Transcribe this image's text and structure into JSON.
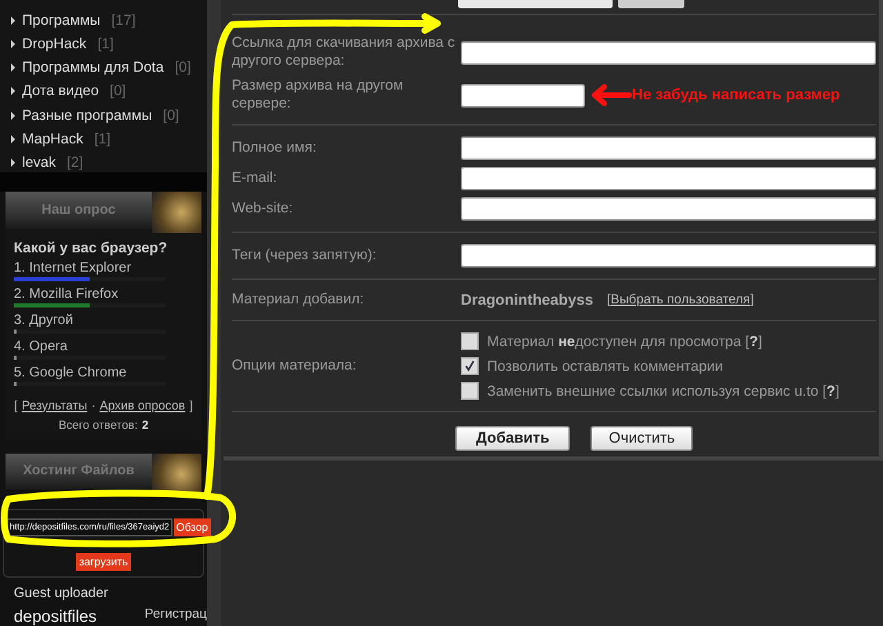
{
  "categories": [
    {
      "name": "Программы",
      "count": "[17]"
    },
    {
      "name": "DropHack",
      "count": "[1]"
    },
    {
      "name": "Программы для Dota",
      "count": "[0]"
    },
    {
      "name": "Дота видео",
      "count": "[0]"
    },
    {
      "name": "Разные программы",
      "count": "[0]"
    },
    {
      "name": "MapHack",
      "count": "[1]"
    },
    {
      "name": "levak",
      "count": "[2]"
    }
  ],
  "poll": {
    "title": "Наш опрос",
    "question": "Какой у вас браузер?",
    "answers": [
      {
        "label": "1. Internet Explorer",
        "level": 0.5,
        "color": "#2b3fd6"
      },
      {
        "label": "2. Mozilla Firefox",
        "level": 0.5,
        "color": "#1f7a2e"
      },
      {
        "label": "3. Другой",
        "level": 0,
        "color": "#888888"
      },
      {
        "label": "4. Opera",
        "level": 0,
        "color": "#888888"
      },
      {
        "label": "5. Google Chrome",
        "level": 0,
        "color": "#888888"
      }
    ],
    "open_bracket": "[",
    "links": [
      "Результаты",
      "Архив опросов"
    ],
    "separator": "·",
    "close_bracket": "]",
    "total_label": "Всего ответов:",
    "total": "2"
  },
  "hosting": {
    "title": "Хостинг Файлов",
    "url": "http://depositfiles.com/ru/files/367eaiyd2",
    "browse": "Обзор",
    "upload": "загрузить",
    "uploader": "Guest uploader",
    "service": "depositfiles",
    "register": "Регистрац"
  },
  "form": {
    "sections": [
      [
        {
          "kind": "field",
          "label": "Ссылка для скачивания архива с другого сервера:"
        },
        {
          "kind": "short_field",
          "label": "Размер архива на другом сервере:",
          "note": "Не забудь написать размер"
        }
      ],
      [
        {
          "kind": "field",
          "label": "Полное имя:"
        },
        {
          "kind": "field",
          "label": "E-mail:"
        },
        {
          "kind": "field",
          "label": "Web-site:"
        }
      ],
      [
        {
          "kind": "field",
          "label": "Теги (через запятую):"
        }
      ],
      [
        {
          "kind": "author",
          "label": "Материал добавил:",
          "value": "Dragonintheabyss",
          "open_bracket": "[",
          "link": "Выбрать пользователя",
          "close_bracket": "]"
        }
      ],
      [
        {
          "kind": "options",
          "label": "Опции материала:",
          "options": [
            {
              "text": "Материал **не**доступен для просмотра [**?**]",
              "checked": false
            },
            {
              "text": "Позволить оставлять комментарии",
              "checked": true
            },
            {
              "text": "Заменить внешние ссылки используя сервис u.to [**?**]",
              "checked": false
            }
          ]
        }
      ]
    ],
    "buttons": [
      {
        "label": "Добавить",
        "kind": "primary"
      },
      {
        "label": "Очистить",
        "kind": "secondary"
      }
    ]
  }
}
